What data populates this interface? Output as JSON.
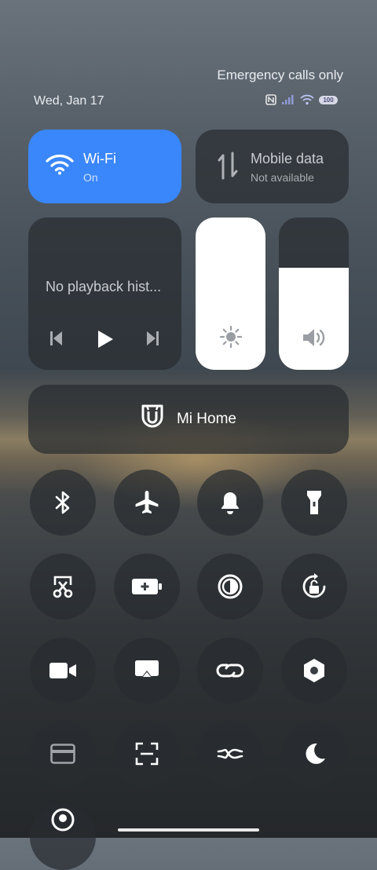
{
  "status": {
    "emergency_text": "Emergency calls only",
    "date": "Wed, Jan 17",
    "battery": "100",
    "icons": [
      "nfc-icon",
      "signal-icon",
      "wifi-icon",
      "battery-icon"
    ]
  },
  "tiles": {
    "wifi": {
      "title": "Wi-Fi",
      "subtitle": "On",
      "color": "#3a86fb"
    },
    "mobile_data": {
      "title": "Mobile data",
      "subtitle": "Not available"
    }
  },
  "media": {
    "title": "No playback hist...",
    "controls": [
      "previous-icon",
      "play-icon",
      "next-icon"
    ]
  },
  "sliders": {
    "brightness_level": 1.0,
    "volume_level": 0.67
  },
  "mi_home": {
    "label": "Mi Home"
  },
  "toggles": [
    "bluetooth",
    "airplane-mode",
    "ringer",
    "flashlight",
    "screenshot",
    "battery-saver",
    "reading-mode",
    "auto-rotate",
    "screen-recorder",
    "cast",
    "link",
    "settings",
    "card",
    "scanner",
    "data-saver",
    "dark-mode",
    "location"
  ]
}
